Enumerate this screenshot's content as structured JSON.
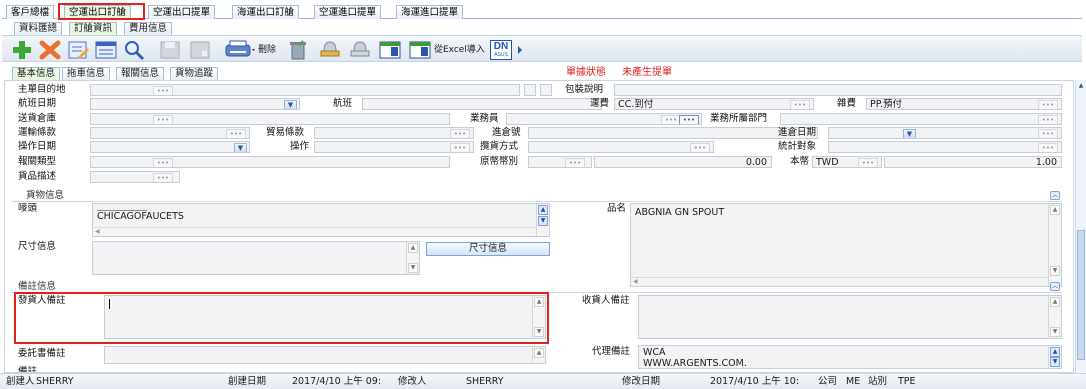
{
  "top_tabs": [
    "客戶總檔",
    "空運出口訂艙",
    "空運出口提單",
    "海運出口訂艙",
    "空運進口提單",
    "海運進口提單"
  ],
  "sub_tabs": [
    "資料匯總",
    "訂艙資訊",
    "費用信息"
  ],
  "toolbar": {
    "delete_label": "刪除",
    "import_label": "從Excel導入",
    "dn_logo": "DN",
    "dn_sub": "ASUS"
  },
  "panel_tabs": [
    "基本信息",
    "拖車信息",
    "報關信息",
    "貨物追蹤"
  ],
  "status": {
    "doc_status_label": "單據狀態",
    "doc_status_value": "未產生提單",
    "accent": "#e0221b"
  },
  "form": {
    "main_destination": "主單目的地",
    "packing_desc": "包裝說明",
    "flight_date": "航班日期",
    "flight": "航班",
    "freight": {
      "label": "運費",
      "value": "CC.到付"
    },
    "misc_fee": {
      "label": "雜費",
      "value": "PP.預付"
    },
    "warehouse": "送貨倉庫",
    "salesperson": "業務員",
    "sales_dept": "業務所屬部門",
    "shipping_terms": "運輸條款",
    "trade_terms": "貿易條款",
    "in_warehouse_no": "進倉號",
    "in_warehouse_date": "進倉日期",
    "op_date": "操作日期",
    "operator": "操作",
    "pickup_method": "攬貨方式",
    "stat_target": "統計對象",
    "customs_type": "報關類型",
    "orig_currency": {
      "label": "原幣幣別",
      "amount": "0.00"
    },
    "base_currency": {
      "label": "本幣",
      "code": "TWD",
      "rate": "1.00"
    },
    "goods_desc": "貨品描述"
  },
  "goods": {
    "title": "貨物信息",
    "marks_label": "嘜頭",
    "marks_value": "CHICAGOFAUCETS",
    "product_label": "品名",
    "product_value": "ABGNIA GN SPOUT",
    "size_label": "尺寸信息",
    "size_button": "尺寸信息"
  },
  "remarks": {
    "title": "備註信息",
    "shipper_label": "發貨人備註",
    "consignee_label": "收貨人備註",
    "entrust_label": "委託書備註",
    "agent_label": "代理備註",
    "agent_value_1": "WCA",
    "agent_value_2": "WWW.ARGENTS.COM.",
    "more_label": "備註"
  },
  "statusbar": {
    "creator_label": "創建人",
    "creator": "SHERRY",
    "created_label": "創建日期",
    "created": "2017/4/10 上午 09:",
    "modifier_label": "修改人",
    "modifier": "SHERRY",
    "modified_label": "修改日期",
    "modified": "2017/4/10 上午 10:",
    "company_label": "公司",
    "company": "ME",
    "station_label": "站別",
    "station": "TPE"
  },
  "icons": [
    "add-icon",
    "delete-x-icon",
    "edit-icon",
    "list-icon",
    "search-icon",
    "save-icon",
    "disk-icon",
    "print-icon",
    "trash-icon",
    "stamp-icon",
    "stamp2-icon",
    "table-icon",
    "excel-icon",
    "dn-logo"
  ]
}
